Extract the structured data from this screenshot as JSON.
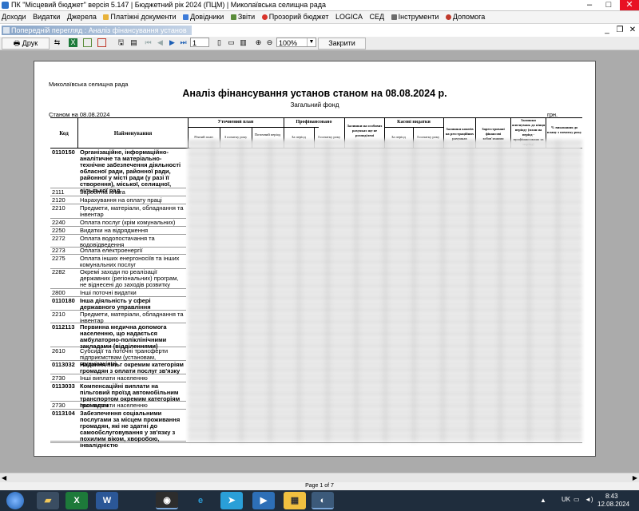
{
  "window": {
    "title": "ПК \"Місцевий бюджет\" версія 5.147 | Бюджетний рік 2024 (ПЦМ) | Миколаївська селищна рада"
  },
  "menu": [
    "Доходи",
    "Видатки",
    "Джерела",
    "Платіжні документи",
    "Довідники",
    "Звіти",
    "Прозорий бюджет",
    "LOGICA",
    "СЕД",
    "Інструменти",
    "Допомога"
  ],
  "preview": {
    "title": "Попередній перегляд : Аналіз фінансування установ",
    "print_label": "Друк",
    "page_value": "1",
    "zoom_value": "100%",
    "close_label": "Закрити"
  },
  "report": {
    "org": "Миколаївська селищна рада",
    "title": "Аналіз фінансування установ станом на 08.08.2024 р.",
    "subtitle": "Загальний фонд",
    "date_line": "Станом на 08.08.2024",
    "currency": "грн.",
    "headers": {
      "code": "Код",
      "name": "Найменування",
      "plan": "Уточнений план",
      "plan_year": "Річний план",
      "plan_from_start": "З початку року",
      "plan_period": "Поточний період",
      "financed": "Профінансовано",
      "fin_period": "За період",
      "fin_from_start": "З початку року",
      "balance": "Залишки на особових рахунках ще не розподілені",
      "cash": "Касові видатки",
      "cash_period": "За період",
      "cash_from_start": "З початку року",
      "reg_balance": "Залишки коштів на реєстраційних рахунках",
      "registered": "Зареєстровані фінансові зобов'язання",
      "remaining": "Залишки асигнувань до кінця періоду (план на період - профінансовано за період)",
      "percent": "% виконання до плану з початку року"
    },
    "rows": [
      {
        "code": "0110150",
        "name": "Організаційне, інформаційно-аналітичне та матеріально-технічне забезпечення діяльності обласної ради, районної ради, районної у місті ради (у разі її створення), міської, селищної, сільської рад",
        "bold": true
      },
      {
        "code": "2111",
        "name": "Заробітна плата",
        "bold": false
      },
      {
        "code": "2120",
        "name": "Нарахування на оплату праці",
        "bold": false
      },
      {
        "code": "2210",
        "name": "Предмети, матеріали, обладнання та інвентар",
        "bold": false
      },
      {
        "code": "2240",
        "name": "Оплата послуг (крім комунальних)",
        "bold": false
      },
      {
        "code": "2250",
        "name": "Видатки на відрядження",
        "bold": false
      },
      {
        "code": "2272",
        "name": "Оплата водопостачання та водовідведення",
        "bold": false
      },
      {
        "code": "2273",
        "name": "Оплата електроенергії",
        "bold": false
      },
      {
        "code": "2275",
        "name": "Оплата інших енергоносіїв та інших комунальних послуг",
        "bold": false
      },
      {
        "code": "2282",
        "name": "Окремі заходи по реалізації державних (регіональних) програм, не віднесені до заходів розвитку",
        "bold": false
      },
      {
        "code": "2800",
        "name": "Інші поточні видатки",
        "bold": false
      },
      {
        "code": "0110180",
        "name": "Інша діяльність у сфері державного управління",
        "bold": true
      },
      {
        "code": "2210",
        "name": "Предмети, матеріали, обладнання та інвентар",
        "bold": false
      },
      {
        "code": "0112113",
        "name": "Первинна медична допомога населенню, що надається амбулаторно-поліклінічними закладами (відділеннями)",
        "bold": true
      },
      {
        "code": "2610",
        "name": "Субсидії та поточні трансферти підприємствам (установам, організаціям)",
        "bold": false
      },
      {
        "code": "0113032",
        "name": "Надання пільг окремим категоріям громадян з оплати послуг зв'язку",
        "bold": true
      },
      {
        "code": "2730",
        "name": "Інші виплати населенню",
        "bold": false
      },
      {
        "code": "0113033",
        "name": "Компенсаційні виплати на пільговий проїзд автомобільним транспортом окремим категоріям громадян",
        "bold": true
      },
      {
        "code": "2730",
        "name": "Інші виплати населенню",
        "bold": false
      },
      {
        "code": "0113104",
        "name": "Забезпечення соціальними послугами за місцем проживання громадян, які не здатні до самообслуговування у зв'язку з похилим віком, хворобою, інвалідністю",
        "bold": true
      }
    ]
  },
  "status": {
    "page_label": "Page 1 of 7"
  },
  "taskbar": {
    "lang": "UK",
    "time": "8:43",
    "date": "12.08.2024"
  },
  "colors": {
    "title_gradient_start": "#8aa6c8",
    "close_red": "#e81123",
    "taskbar_bg": "#1f2d3d"
  }
}
